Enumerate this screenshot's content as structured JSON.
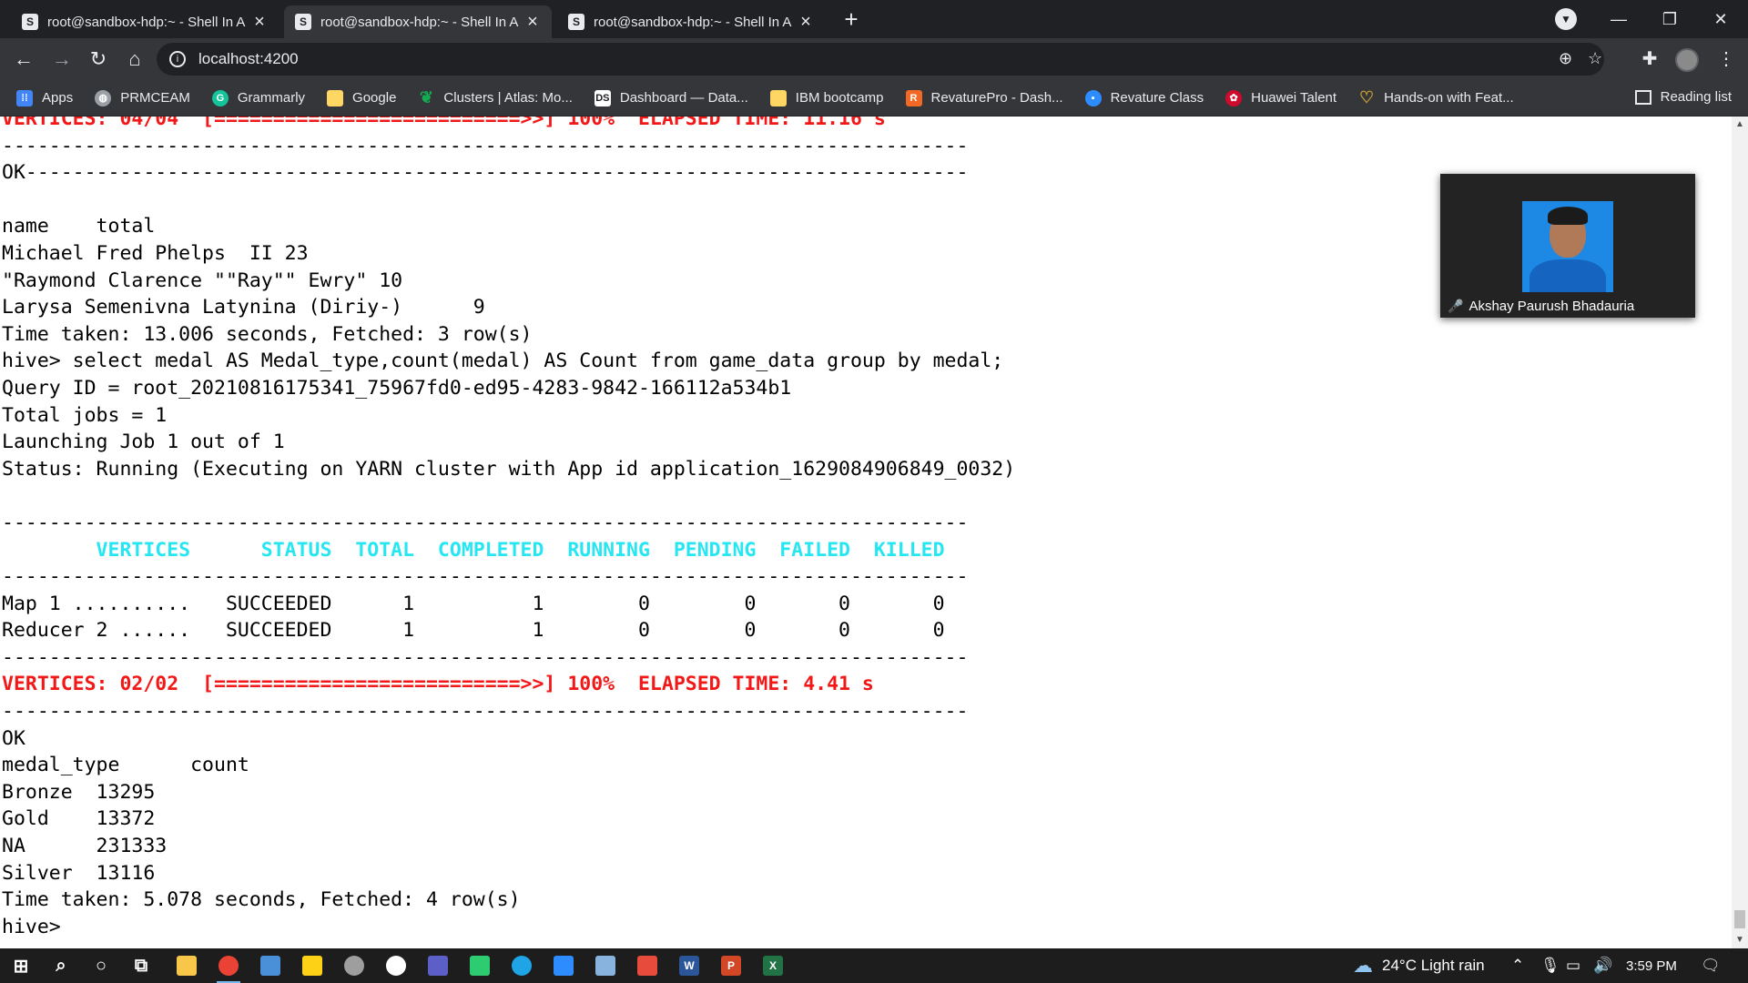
{
  "browser": {
    "tabs": [
      {
        "title": "root@sandbox-hdp:~ - Shell In A",
        "active": false
      },
      {
        "title": "root@sandbox-hdp:~ - Shell In A",
        "active": true
      },
      {
        "title": "root@sandbox-hdp:~ - Shell In A",
        "active": false
      }
    ],
    "url": "localhost:4200",
    "bookmarks": [
      {
        "label": "Apps",
        "icon": "apps-grid-icon",
        "color": "#4285f4"
      },
      {
        "label": "PRMCEAM",
        "icon": "globe-icon",
        "color": "#9aa0a6"
      },
      {
        "label": "Grammarly",
        "icon": "grammarly-icon",
        "color": "#15c39a"
      },
      {
        "label": "Google",
        "icon": "folder-icon",
        "color": "#fdd663"
      },
      {
        "label": "Clusters | Atlas: Mo...",
        "icon": "mongodb-leaf-icon",
        "color": "#13aa52"
      },
      {
        "label": "Dashboard — Data...",
        "icon": "ds-icon",
        "color": "#ffffff"
      },
      {
        "label": "IBM bootcamp",
        "icon": "folder-icon",
        "color": "#fdd663"
      },
      {
        "label": "RevaturePro - Dash...",
        "icon": "revature-icon",
        "color": "#f26925"
      },
      {
        "label": "Revature Class",
        "icon": "zoom-icon",
        "color": "#2d8cff"
      },
      {
        "label": "Huawei Talent",
        "icon": "huawei-icon",
        "color": "#cf0a2c"
      },
      {
        "label": "Hands-on with Feat...",
        "icon": "heart-outline-icon",
        "color": "#c8a030"
      }
    ],
    "reading_list": "Reading list"
  },
  "terminal": {
    "lines": [
      {
        "text": "VERTICES: 04/04  [==========================>>] 100%  ELAPSED TIME: 11.16 s",
        "style": "red"
      },
      {
        "text": "----------------------------------------------------------------------------------",
        "style": ""
      },
      {
        "text": "OK--------------------------------------------------------------------------------",
        "style": ""
      },
      {
        "text": "",
        "style": ""
      },
      {
        "text": "name    total",
        "style": ""
      },
      {
        "text": "Michael Fred Phelps  II 23",
        "style": ""
      },
      {
        "text": "\"Raymond Clarence \"\"Ray\"\" Ewry\" 10",
        "style": ""
      },
      {
        "text": "Larysa Semenivna Latynina (Diriy-)      9",
        "style": ""
      },
      {
        "text": "Time taken: 13.006 seconds, Fetched: 3 row(s)",
        "style": ""
      },
      {
        "text": "hive> select medal AS Medal_type,count(medal) AS Count from game_data group by medal;",
        "style": ""
      },
      {
        "text": "Query ID = root_20210816175341_75967fd0-ed95-4283-9842-166112a534b1",
        "style": ""
      },
      {
        "text": "Total jobs = 1",
        "style": ""
      },
      {
        "text": "Launching Job 1 out of 1",
        "style": ""
      },
      {
        "text": "Status: Running (Executing on YARN cluster with App id application_1629084906849_0032)",
        "style": ""
      },
      {
        "text": "",
        "style": ""
      },
      {
        "text": "----------------------------------------------------------------------------------",
        "style": ""
      },
      {
        "text": "        VERTICES      STATUS  TOTAL  COMPLETED  RUNNING  PENDING  FAILED  KILLED",
        "style": "cyan"
      },
      {
        "text": "----------------------------------------------------------------------------------",
        "style": ""
      },
      {
        "text": "Map 1 ..........   SUCCEEDED      1          1        0        0       0       0",
        "style": ""
      },
      {
        "text": "Reducer 2 ......   SUCCEEDED      1          1        0        0       0       0",
        "style": ""
      },
      {
        "text": "----------------------------------------------------------------------------------",
        "style": ""
      },
      {
        "text": "VERTICES: 02/02  [==========================>>] 100%  ELAPSED TIME: 4.41 s",
        "style": "red"
      },
      {
        "text": "----------------------------------------------------------------------------------",
        "style": ""
      },
      {
        "text": "OK",
        "style": ""
      },
      {
        "text": "medal_type      count",
        "style": ""
      },
      {
        "text": "Bronze  13295",
        "style": ""
      },
      {
        "text": "Gold    13372",
        "style": ""
      },
      {
        "text": "NA      231333",
        "style": ""
      },
      {
        "text": "Silver  13116",
        "style": ""
      },
      {
        "text": "Time taken: 5.078 seconds, Fetched: 4 row(s)",
        "style": ""
      },
      {
        "text": "hive>",
        "style": ""
      }
    ]
  },
  "video": {
    "participant_name": "Akshay Paurush Bhadauria",
    "mic_status": "muted"
  },
  "taskbar": {
    "weather": "24°C  Light rain",
    "time": "3:59 PM",
    "apps": [
      {
        "icon": "windows-start-icon",
        "color": "#ffffff",
        "glyph": "⊞"
      },
      {
        "icon": "search-icon",
        "color": "#ffffff",
        "glyph": "⌕"
      },
      {
        "icon": "cortana-icon",
        "color": "#ffffff",
        "glyph": "○"
      },
      {
        "icon": "task-view-icon",
        "color": "#ffffff",
        "glyph": "⧉"
      },
      {
        "icon": "file-explorer-icon",
        "color": "#f8c74a",
        "glyph": ""
      },
      {
        "icon": "chrome-icon",
        "color": "#ea4335",
        "glyph": ""
      },
      {
        "icon": "remote-desktop-icon",
        "color": "#4a90d9",
        "glyph": ""
      },
      {
        "icon": "sticky-notes-icon",
        "color": "#fcd116",
        "glyph": ""
      },
      {
        "icon": "settings-app-icon",
        "color": "#9e9e9e",
        "glyph": ""
      },
      {
        "icon": "app-circle-icon",
        "color": "#ffffff",
        "glyph": ""
      },
      {
        "icon": "teams-icon",
        "color": "#5b5fc7",
        "glyph": ""
      },
      {
        "icon": "paint-icon",
        "color": "#2ecc71",
        "glyph": ""
      },
      {
        "icon": "edge-icon",
        "color": "#1fa4e6",
        "glyph": ""
      },
      {
        "icon": "zoom-app-icon",
        "color": "#2d8cff",
        "glyph": ""
      },
      {
        "icon": "virtualbox-icon",
        "color": "#88b3de",
        "glyph": ""
      },
      {
        "icon": "sqldeveloper-icon",
        "color": "#e64b3c",
        "glyph": ""
      },
      {
        "icon": "word-icon",
        "color": "#2b579a",
        "glyph": "W"
      },
      {
        "icon": "powerpoint-icon",
        "color": "#d24726",
        "glyph": "P"
      },
      {
        "icon": "excel-icon",
        "color": "#217346",
        "glyph": "X"
      }
    ]
  }
}
